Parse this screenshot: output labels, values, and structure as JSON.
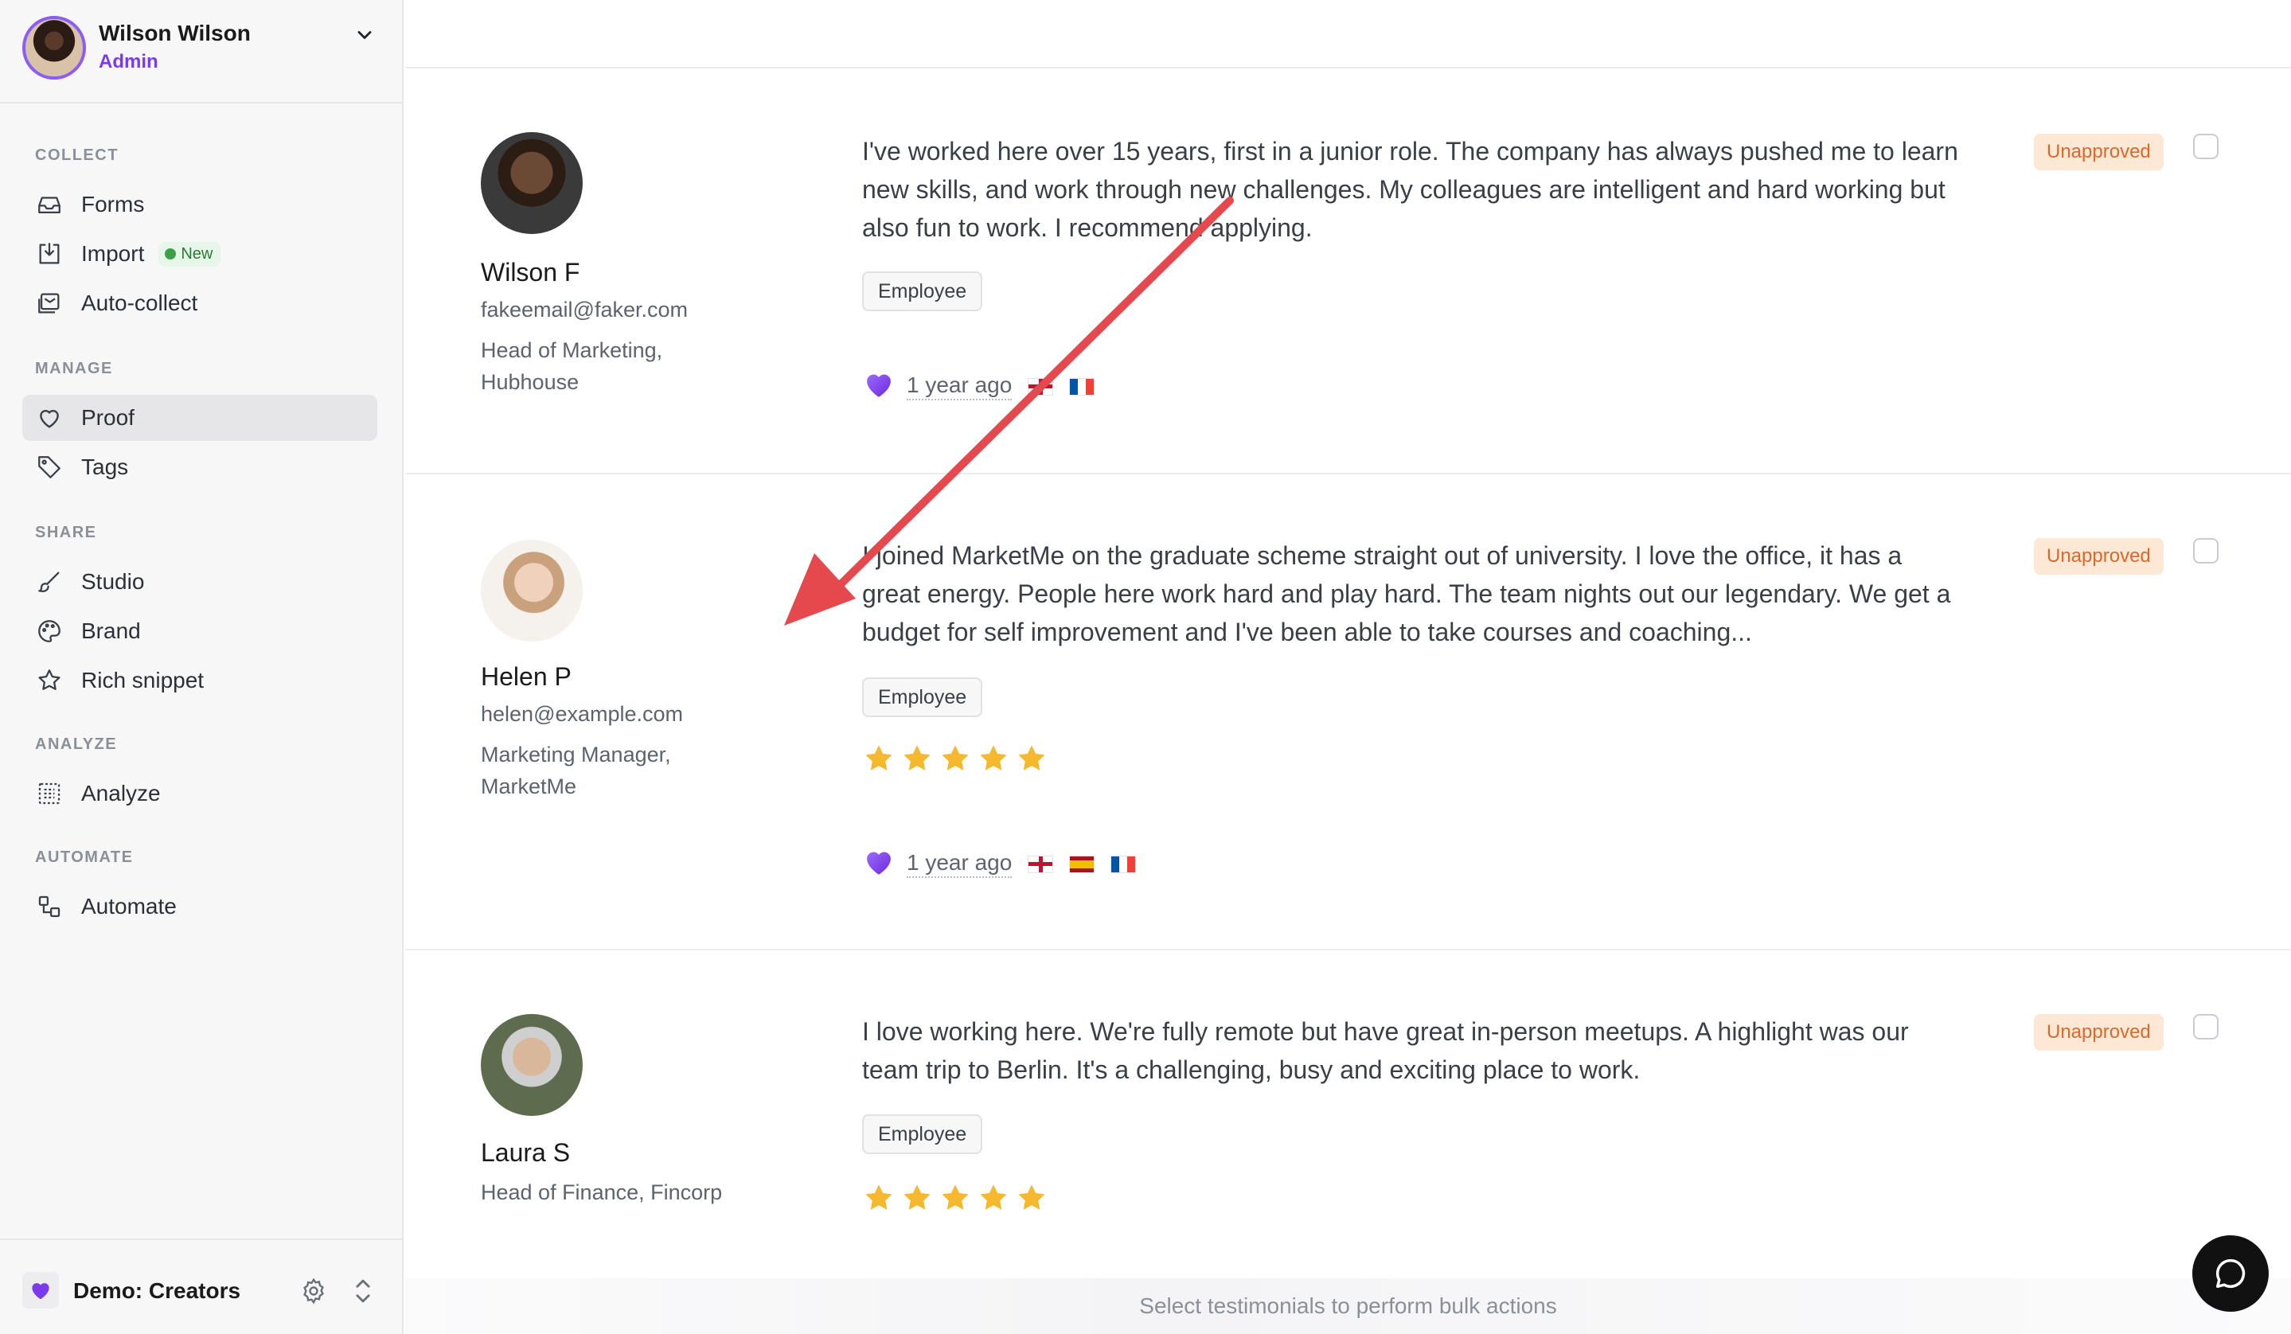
{
  "user": {
    "name": "Wilson Wilson",
    "role": "Admin"
  },
  "sidebar": {
    "sections": [
      {
        "label": "COLLECT",
        "items": [
          {
            "label": "Forms",
            "icon": "inbox-icon"
          },
          {
            "label": "Import",
            "icon": "import-icon",
            "badge": "New"
          },
          {
            "label": "Auto-collect",
            "icon": "auto-collect-icon"
          }
        ]
      },
      {
        "label": "MANAGE",
        "items": [
          {
            "label": "Proof",
            "icon": "heart-outline-icon",
            "active": true
          },
          {
            "label": "Tags",
            "icon": "tag-icon"
          }
        ]
      },
      {
        "label": "SHARE",
        "items": [
          {
            "label": "Studio",
            "icon": "brush-icon"
          },
          {
            "label": "Brand",
            "icon": "palette-icon"
          },
          {
            "label": "Rich snippet",
            "icon": "star-outline-icon"
          }
        ]
      },
      {
        "label": "ANALYZE",
        "items": [
          {
            "label": "Analyze",
            "icon": "analyze-icon"
          }
        ]
      },
      {
        "label": "AUTOMATE",
        "items": [
          {
            "label": "Automate",
            "icon": "automate-icon"
          }
        ]
      }
    ],
    "workspace": "Demo: Creators"
  },
  "testimonials": [
    {
      "name": "Wilson F",
      "email": "fakeemail@faker.com",
      "title": "Head of Marketing, Hubhouse",
      "text": "I've worked here over 15 years, first in a junior role. The company has always pushed me to learn new skills, and work through new challenges. My colleagues are intelligent and hard working but also fun to work. I recommend applying.",
      "tag": "Employee",
      "rating": null,
      "time": "1 year ago",
      "flags": [
        "en",
        "fr"
      ],
      "status": "Unapproved"
    },
    {
      "name": "Helen P",
      "email": "helen@example.com",
      "title": "Marketing Manager, MarketMe",
      "text": "I joined MarketMe on the graduate scheme straight out of university. I love the office, it has a great energy. People here work hard and play hard. The team nights out our legendary. We get a budget for self improvement and I've been able to take courses and coaching...",
      "tag": "Employee",
      "rating": 5,
      "time": "1 year ago",
      "flags": [
        "en",
        "es",
        "fr"
      ],
      "status": "Unapproved"
    },
    {
      "name": "Laura S",
      "email": "",
      "title": "Head of Finance, Fincorp",
      "text": "I love working here. We're fully remote but have great in-person meetups. A highlight was our team trip to Berlin. It's a challenging, busy and exciting place to work.",
      "tag": "Employee",
      "rating": 5,
      "time": "",
      "flags": [],
      "status": "Unapproved"
    }
  ],
  "bulk_bar": {
    "text": "Select testimonials to perform bulk actions"
  },
  "colors": {
    "accent": "#7c3aed",
    "status_bg": "#fde8d6",
    "status_text": "#d9692a",
    "star": "#f5b82e",
    "annotation_arrow": "#e5484d"
  }
}
